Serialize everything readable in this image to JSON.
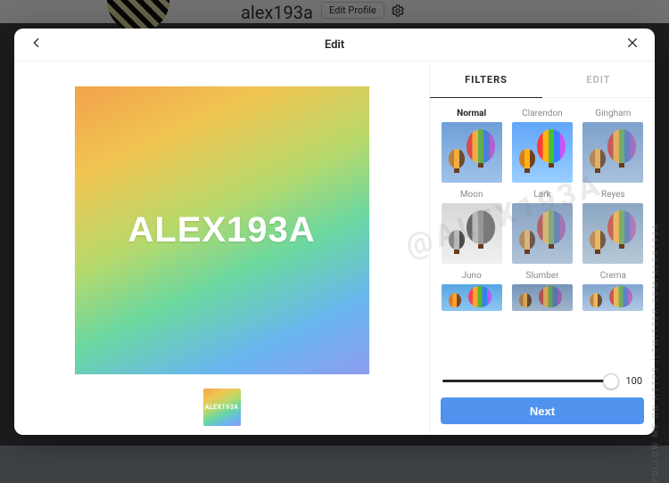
{
  "background": {
    "username": "alex193a",
    "edit_profile_label": "Edit Profile"
  },
  "modal": {
    "title": "Edit"
  },
  "preview": {
    "overlay_text": "ALEX193A",
    "thumb_text": "ALEX193A"
  },
  "tabs": {
    "filters": "FILTERS",
    "edit": "EDIT",
    "active": "filters"
  },
  "filters": [
    {
      "name": "Normal",
      "css": "f-normal",
      "selected": true
    },
    {
      "name": "Clarendon",
      "css": "f-clarendon",
      "selected": false
    },
    {
      "name": "Gingham",
      "css": "f-gingham",
      "selected": false
    },
    {
      "name": "Moon",
      "css": "f-moon",
      "selected": false
    },
    {
      "name": "Lark",
      "css": "f-lark",
      "selected": false
    },
    {
      "name": "Reyes",
      "css": "f-reyes",
      "selected": false
    },
    {
      "name": "Juno",
      "css": "f-juno",
      "selected": false
    },
    {
      "name": "Slumber",
      "css": "f-slumber",
      "selected": false
    },
    {
      "name": "Crema",
      "css": "f-crema",
      "selected": false
    }
  ],
  "slider": {
    "value": 100
  },
  "next_label": "Next",
  "watermark": {
    "vertical": "FOLLOW ME ON HTTPS://TWITTER.COM/ALEX193A",
    "diagonal": "@ALEX193A"
  }
}
